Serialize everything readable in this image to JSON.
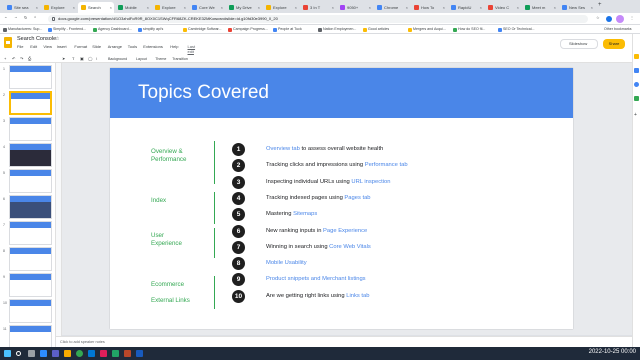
{
  "browser": {
    "tabs": [
      {
        "label": "Site sea",
        "color": "#4285f4"
      },
      {
        "label": "Explore",
        "color": "#f4b400"
      },
      {
        "label": "Search",
        "color": "#f4b400",
        "active": true
      },
      {
        "label": "Mobile",
        "color": "#0f9d58"
      },
      {
        "label": "Explore",
        "color": "#f4b400"
      },
      {
        "label": "Core We",
        "color": "#4285f4"
      },
      {
        "label": "My Drive",
        "color": "#0f9d58"
      },
      {
        "label": "Explore",
        "color": "#f4b400"
      },
      {
        "label": "3 In T",
        "color": "#ea4335"
      },
      {
        "label": "9050+",
        "color": "#a142f4"
      },
      {
        "label": "Chrome",
        "color": "#4285f4"
      },
      {
        "label": "How To",
        "color": "#ea4335"
      },
      {
        "label": "RapidU",
        "color": "#4285f4"
      },
      {
        "label": "Video C",
        "color": "#ea4335"
      },
      {
        "label": "Meet m",
        "color": "#0f9d58"
      },
      {
        "label": "New Ses",
        "color": "#4285f4"
      }
    ],
    "url": "docs.google.com/presentation/d/1O3zhdFoR9R_8OX0C1SWqCFR68ZK-CREKE32MKowcwv#slide=id.g10fd30e3990_0_20",
    "bookmarks": [
      {
        "label": "Manufacturers: Sup...",
        "color": "#5f6368"
      },
      {
        "label": "Simplify - Frontend...",
        "color": "#4285f4"
      },
      {
        "label": "Agency Dashboard...",
        "color": "#34a853"
      },
      {
        "label": "simplify api's",
        "color": "#4285f4"
      },
      {
        "label": "Cambridge Softwar...",
        "color": "#fbbc04"
      },
      {
        "label": "Campaign Progress...",
        "color": "#ea4335"
      },
      {
        "label": "People at Tuck",
        "color": "#4285f4"
      },
      {
        "label": "Nation Employmen...",
        "color": "#5f6368"
      },
      {
        "label": "Good articles",
        "color": "#fbbc04"
      },
      {
        "label": "Mergers and Acqui...",
        "color": "#fbbc04"
      },
      {
        "label": "How do SEO fil...",
        "color": "#34a853"
      },
      {
        "label": "SEO Or Technical...",
        "color": "#4285f4"
      }
    ],
    "other_bookmarks": "Other bookmarks"
  },
  "slides_app": {
    "doc_title": "Search Console",
    "menu": [
      "File",
      "Edit",
      "View",
      "Insert",
      "Format",
      "Slide",
      "Arrange",
      "Tools",
      "Extensions",
      "Help"
    ],
    "last_edit": "Last edit was...",
    "slideshow_label": "Slideshow",
    "share_label": "Share",
    "toolbar_items": [
      "Background",
      "Layout",
      "Theme",
      "Transition"
    ],
    "speaker_notes": "Click to add speaker notes",
    "thumb_numbers": [
      "1",
      "2",
      "3",
      "4",
      "5",
      "6",
      "7",
      "8",
      "9",
      "10",
      "11"
    ]
  },
  "slide": {
    "title": "Topics Covered",
    "categories": [
      {
        "label": "Overview &\nPerformance"
      },
      {
        "label": "Index"
      },
      {
        "label": "User\nExperience"
      },
      {
        "label": "Ecommerce"
      },
      {
        "label": "External Links"
      }
    ],
    "items": [
      {
        "num": "1",
        "pre": "",
        "link": "Overview tab",
        "post": " to assess overall website health"
      },
      {
        "num": "2",
        "pre": "Tracking clicks and impressions using ",
        "link": "Performance tab",
        "post": ""
      },
      {
        "num": "3",
        "pre": "Inspecting individual URLs using ",
        "link": "URL inspection",
        "post": ""
      },
      {
        "num": "4",
        "pre": "Tracking indexed pages using ",
        "link": "Pages tab",
        "post": ""
      },
      {
        "num": "5",
        "pre": "Mastering ",
        "link": "Sitemaps",
        "post": ""
      },
      {
        "num": "6",
        "pre": "New ranking inputs in ",
        "link": "Page Experience",
        "post": ""
      },
      {
        "num": "7",
        "pre": "Winning in search using ",
        "link": "Core Web Vitals",
        "post": ""
      },
      {
        "num": "8",
        "pre": "",
        "link": "Mobile Usability",
        "post": ""
      },
      {
        "num": "9",
        "pre": "",
        "link": "Product snippets and Merchant listings",
        "post": ""
      },
      {
        "num": "10",
        "pre": "Are we getting right links using ",
        "link": "Links tab",
        "post": ""
      }
    ],
    "colors": {
      "header": "#4a86e8",
      "category": "#34a853",
      "link": "#4a86e8"
    }
  },
  "taskbar": {
    "datetime": "2022-10-25  00:00"
  }
}
